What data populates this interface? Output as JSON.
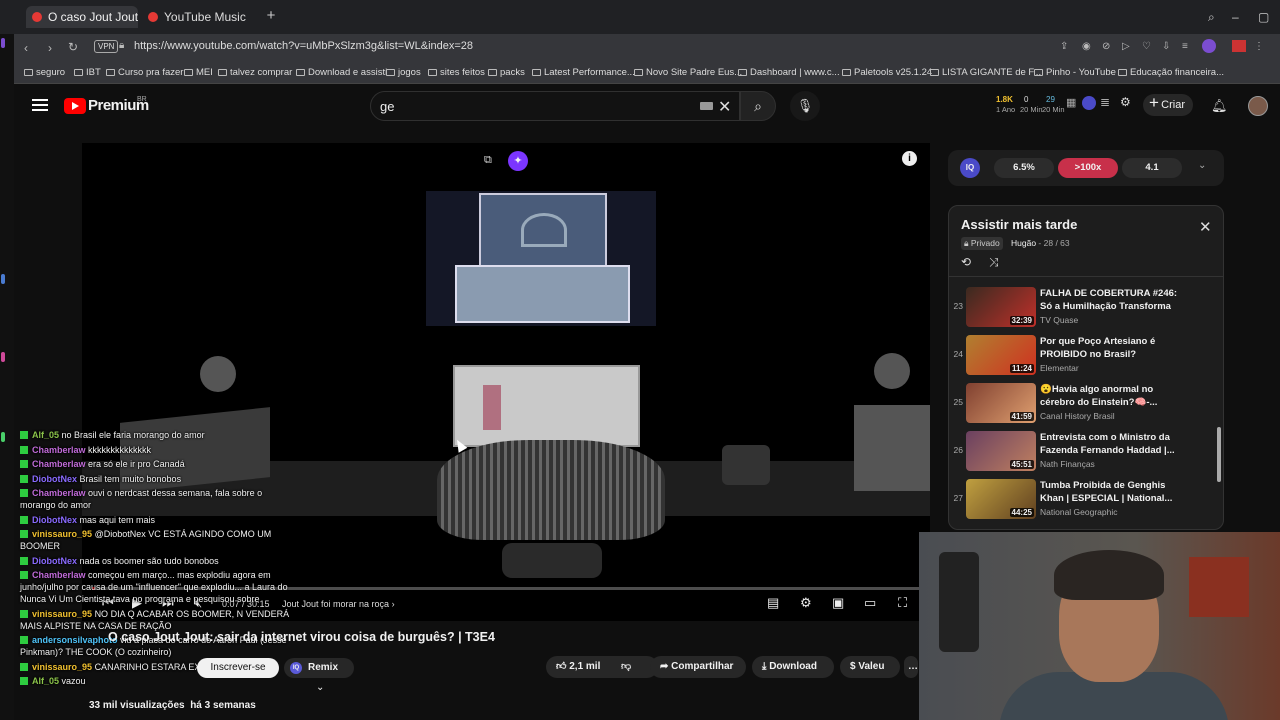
{
  "browser": {
    "tabs": [
      {
        "label": "O caso Jout Jout: sair da"
      },
      {
        "label": "YouTube Music"
      }
    ],
    "url": "https://www.youtube.com/watch?v=uMbPxSlzm3g&list=WL&index=28",
    "vpn": "VPN",
    "bookmarks": [
      "seguro",
      "IBT",
      "Curso pra fazer",
      "MEI",
      "talvez comprar",
      "Download e assisti",
      "jogos",
      "sites feitos",
      "packs",
      "Latest Performance...",
      "Novo Site Padre Eus...",
      "Dashboard | www.c...",
      "Paletools v25.1.24",
      "LISTA GIGANTE de F...",
      "Pinho - YouTube",
      "Educação financeira..."
    ]
  },
  "youtube": {
    "logo": "Premium",
    "region": "BR",
    "search_value": "ge",
    "create_label": "Criar",
    "ext_stats": {
      "a": "1.8K",
      "a_sub": "1 Ano",
      "b": "0",
      "b_sub": "20 Min",
      "c": "29",
      "c_sub": "20 Min"
    }
  },
  "player": {
    "time": "0:07 / 30:15",
    "chapter": "Jout Jout foi morar na roça",
    "progress_fraction": 0.004
  },
  "chat": [
    {
      "user": "Alf_05",
      "color": "#8bc34a",
      "msg": "no Brasil ele faria morango do amor"
    },
    {
      "user": "Chamberlaw",
      "color": "#c06bd8",
      "msg": "kkkkkkkkkkkkkk"
    },
    {
      "user": "Chamberlaw",
      "color": "#c06bd8",
      "msg": "era só ele ir pro Canadá"
    },
    {
      "user": "DiobotNex",
      "color": "#8a6bff",
      "msg": "Brasil tem muito bonobos"
    },
    {
      "user": "Chamberlaw",
      "color": "#c06bd8",
      "msg": "ouvi o nerdcast dessa semana, fala sobre o morango do amor"
    },
    {
      "user": "DiobotNex",
      "color": "#8a6bff",
      "msg": "mas aqui tem mais"
    },
    {
      "user": "vinissauro_95",
      "color": "#f0c030",
      "msg": "@DiobotNex VC ESTÁ AGINDO COMO UM BOOMER"
    },
    {
      "user": "DiobotNex",
      "color": "#8a6bff",
      "msg": "nada os boomer são tudo bonobos"
    },
    {
      "user": "Chamberlaw",
      "color": "#c06bd8",
      "msg": "começou em março... mas explodiu agora em junho/julho por causa de um \"influencer\" que explodiu... a Laura do Nunca Vi Um Cientista tava no programa e pesquisou sobre"
    },
    {
      "user": "vinissauro_95",
      "color": "#f0c030",
      "msg": "NO DIA Q ACABAR OS BOOMER, N VENDERÁ MAIS ALPISTE NA CASA DE RAÇÃO"
    },
    {
      "user": "andersonsilvaphoto",
      "color": "#4fc3f7",
      "msg": "viu a placa do carro do Aaron Paul (Jesse Pinkman)? THE COOK (O cozinheiro)"
    },
    {
      "user": "vinissauro_95",
      "color": "#f0c030",
      "msg": "CANARINHO ESTARA EXTINTO"
    },
    {
      "user": "Alf_05",
      "color": "#8bc34a",
      "msg": "vazou"
    }
  ],
  "video": {
    "title": "O caso Jout Jout: sair da internet virou coisa de burguês? | T3E4",
    "subscribe": "Inscrever-se",
    "remix": "Remix",
    "likes": "2,1 mil",
    "share": "Compartilhar",
    "download": "Download",
    "thanks": "Valeu",
    "views": "33 mil visualizações",
    "age": "há 3 semanas"
  },
  "iq": {
    "logo": "IQ",
    "v1": "6.5%",
    "v2": ">100x",
    "v3": "4.1"
  },
  "playlist": {
    "title": "Assistir mais tarde",
    "privacy": "Privado",
    "owner": "Hugão",
    "position": "28 / 63",
    "items": [
      {
        "n": "23",
        "title": "FALHA DE COBERTURA #246: Só a Humilhação Transforma",
        "channel": "TV Quase",
        "dur": "32:39",
        "c1": "#3a2a20",
        "c2": "#c0302a"
      },
      {
        "n": "24",
        "title": "Por que Poço Artesiano é PROIBIDO no Brasil?",
        "channel": "Elementar",
        "dur": "11:24",
        "c1": "#b08030",
        "c2": "#d03020"
      },
      {
        "n": "25",
        "title": "😮Havia algo anormal no cérebro do Einstein?🧠-...",
        "channel": "Canal History Brasil",
        "dur": "41:59",
        "c1": "#804030",
        "c2": "#e0a070"
      },
      {
        "n": "26",
        "title": "Entrevista com o Ministro da Fazenda Fernando Haddad |...",
        "channel": "Nath Finanças",
        "dur": "45:51",
        "c1": "#6a4060",
        "c2": "#c08060"
      },
      {
        "n": "27",
        "title": "Tumba Proibida de Genghis Khan | ESPECIAL | National...",
        "channel": "National Geographic",
        "dur": "44:25",
        "c1": "#c0a040",
        "c2": "#604020"
      }
    ]
  }
}
